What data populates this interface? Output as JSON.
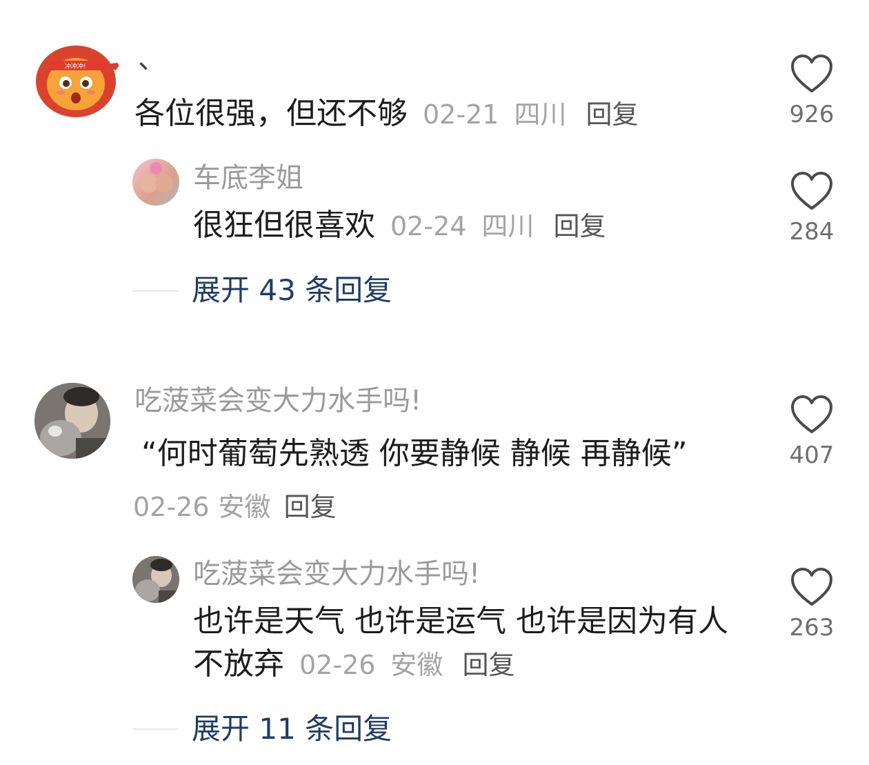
{
  "comments": [
    {
      "username": "、",
      "text": "各位很强，但还不够",
      "date": "02-21",
      "location": "四川",
      "reply_label": "回复",
      "likes": "926",
      "replies": [
        {
          "username": "车底李姐",
          "text": "很狂但很喜欢",
          "date": "02-24",
          "location": "四川",
          "reply_label": "回复",
          "likes": "284"
        }
      ],
      "expand_label": "展开 43 条回复"
    },
    {
      "username": "吃菠菜会变大力水手吗!",
      "text": "“何时葡萄先熟透 你要静候 静候  再静候”",
      "date": "02-26",
      "location": "安徽",
      "reply_label": "回复",
      "likes": "407",
      "replies": [
        {
          "username": "吃菠菜会变大力水手吗!",
          "text": "也许是天气 也许是运气  也许是因为有人不放弃",
          "date": "02-26",
          "location": "安徽",
          "reply_label": "回复",
          "likes": "263"
        }
      ],
      "expand_label": "展开 11 条回复"
    }
  ],
  "colors": {
    "accent_link": "#1f3c66",
    "meta_gray": "#a3a3a3",
    "lion_avatar": "#d9432e"
  },
  "icons": {
    "like": "heart-outline-icon"
  }
}
